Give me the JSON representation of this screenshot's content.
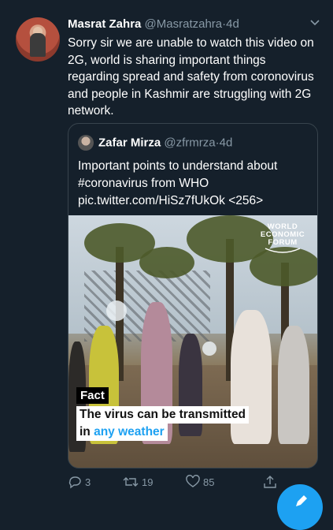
{
  "tweet": {
    "author_name": "Masrat Zahra",
    "author_handle": "@Masratzahra",
    "separator": "·",
    "time": "4d",
    "text": "Sorry sir we are unable to watch this video on 2G, world is sharing important things regarding spread and safety from coronovirus and people in Kashmir are struggling with 2G network."
  },
  "quoted": {
    "author_name": "Zafar Mirza",
    "author_handle": "@zfrmrza",
    "separator": "·",
    "time": "4d",
    "text_line1": "Important points to understand about",
    "text_line2": "#coronavirus from WHO",
    "text_line3": "pic.twitter.com/HiSz7fUkOk <256>"
  },
  "media": {
    "watermark_line1": "WORLD",
    "watermark_line2": "ECONOMIC",
    "watermark_line3": "FORUM",
    "fact_label": "Fact",
    "caption_line1": "The virus can be transmitted",
    "caption_line2_prefix": "in ",
    "caption_line2_accent": "any weather"
  },
  "actions": {
    "replies": "3",
    "retweets": "19",
    "likes": "85"
  },
  "colors": {
    "background": "#15202b",
    "accent": "#1da1f2",
    "secondary_text": "#8899a6",
    "border": "#38444d"
  },
  "icons": [
    "chevron-down-icon",
    "reply-icon",
    "retweet-icon",
    "like-icon",
    "share-icon",
    "compose-icon"
  ]
}
